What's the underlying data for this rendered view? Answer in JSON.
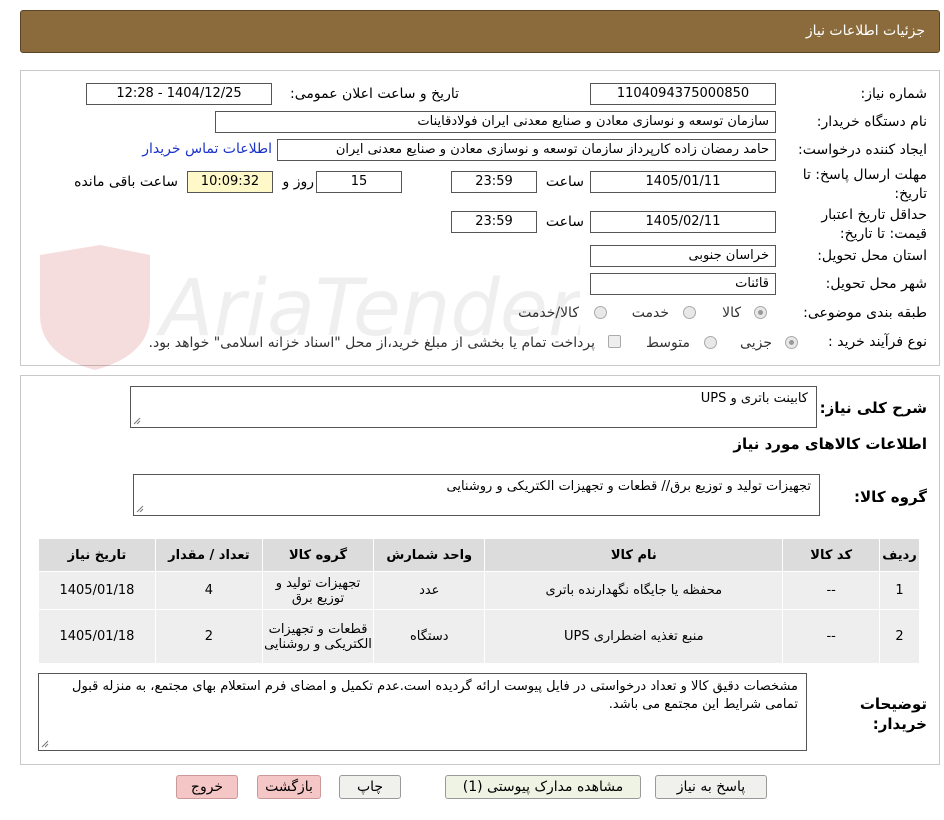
{
  "header": {
    "title": "جزئیات اطلاعات نیاز"
  },
  "fields": {
    "need_number_label": "شماره نیاز:",
    "need_number": "1104094375000850",
    "announce_label": "تاریخ و ساعت اعلان عمومی:",
    "announce_value": "1404/12/25 - 12:28",
    "buyer_org_label": "نام دستگاه خریدار:",
    "buyer_org": "سازمان توسعه و نوسازی معادن و صنایع معدنی ایران فولادقاینات",
    "requester_label": "ایجاد کننده درخواست:",
    "requester": "حامد  رمضان زاده  کارپرداز  سازمان توسعه و نوسازی معادن و صنایع معدنی ایران",
    "contact_link": "اطلاعات تماس خریدار",
    "deadline_label": "مهلت ارسال پاسخ: تا تاریخ:",
    "deadline_date": "1405/01/11",
    "time_label": "ساعت",
    "deadline_time": "23:59",
    "days_value": "15",
    "days_label": "روز و",
    "remaining_time": "10:09:32",
    "remaining_label": "ساعت باقی مانده",
    "validity_label": "حداقل تاریخ اعتبار قیمت: تا تاریخ:",
    "validity_date": "1405/02/11",
    "validity_time": "23:59",
    "province_label": "استان محل تحویل:",
    "province": "خراسان جنوبی",
    "city_label": "شهر محل تحویل:",
    "city": "قائنات",
    "category_label": "طبقه بندی موضوعی:",
    "category_options": [
      "کالا",
      "خدمت",
      "کالا/خدمت"
    ],
    "process_label": "نوع فرآیند خرید :",
    "process_options": [
      "جزیی",
      "متوسط"
    ],
    "payment_note": "پرداخت تمام یا بخشی از مبلغ خرید،از محل \"اسناد خزانه اسلامی\" خواهد بود."
  },
  "summary": {
    "label": "شرح کلی نیاز:",
    "value": "کابینت باتری و UPS",
    "items_title": "اطلاعات کالاهای مورد نیاز",
    "group_label": "گروه کالا:",
    "group_value": "تجهیزات تولید و توزیع برق// قطعات و تجهیزات الکتریکی و روشنایی"
  },
  "table": {
    "headers": [
      "ردیف",
      "کد کالا",
      "نام کالا",
      "واحد شمارش",
      "گروه کالا",
      "تعداد / مقدار",
      "تاریخ نیاز"
    ],
    "rows": [
      [
        "1",
        "--",
        "محفظه یا جایگاه نگهدارنده باتری",
        "عدد",
        "تجهیزات تولید و توزیع برق",
        "4",
        "1405/01/18"
      ],
      [
        "2",
        "--",
        "منبع تغذیه اضطراری UPS",
        "دستگاه",
        "قطعات و تجهیزات الکتریکی و روشنایی",
        "2",
        "1405/01/18"
      ]
    ]
  },
  "notes": {
    "label": "توضیحات خریدار:",
    "value": "مشخصات دقیق کالا و تعداد درخواستی در فایل پیوست ارائه گردیده است.عدم تکمیل و امضای فرم استعلام بهای مجتمع، به منزله قبول تمامی شرایط این مجتمع می باشد."
  },
  "buttons": {
    "reply": "پاسخ به نیاز",
    "attachments": "مشاهده مدارک پیوستی (1)",
    "print": "چاپ",
    "back": "بازگشت",
    "exit": "خروج"
  },
  "watermark": {
    "text": "AriaTender.net"
  },
  "colors": {
    "header": "#8b6b3c",
    "link": "#1a33c9",
    "remaining_bg": "#fff8c8",
    "exit_bg": "#f4c6c6"
  }
}
